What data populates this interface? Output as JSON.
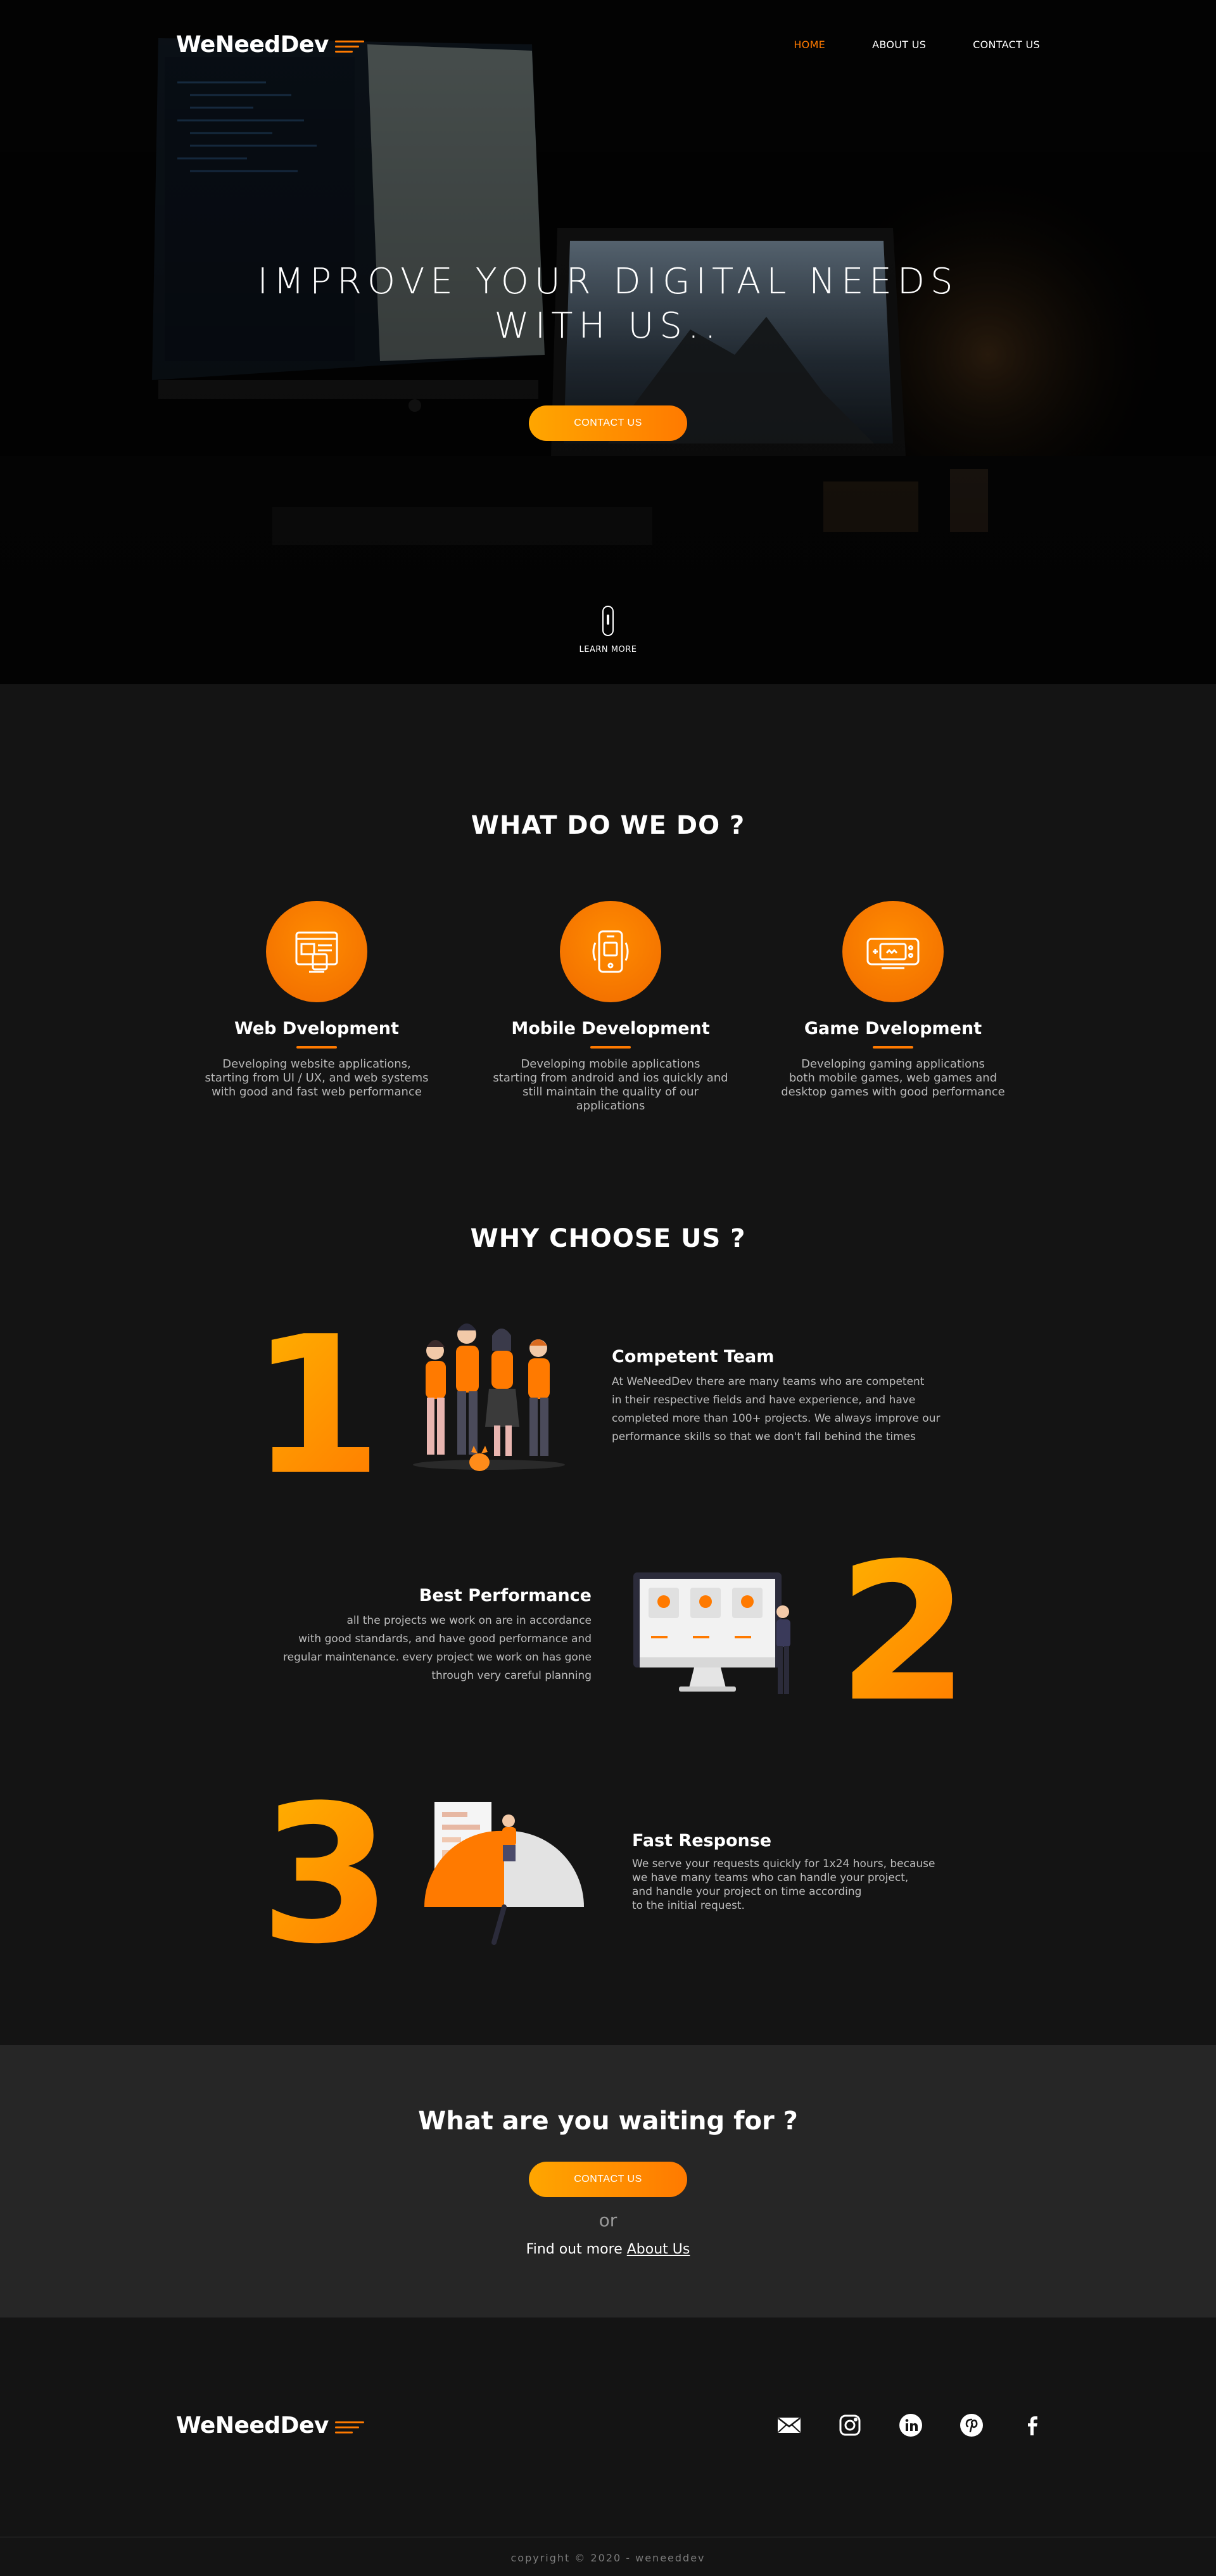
{
  "brand": {
    "name": "WeNeedDev",
    "accent": "#ff7a00"
  },
  "nav": {
    "items": [
      "HOME",
      "ABOUT US",
      "CONTACT US"
    ]
  },
  "hero": {
    "title_line1": "IMPROVE YOUR DIGITAL NEEDS",
    "title_line2": "WITH US..",
    "cta_label": "CONTACT US",
    "scroll_label": "LEARN MORE"
  },
  "services": {
    "title": "WHAT DO WE DO ?",
    "items": [
      {
        "icon": "web-icon",
        "title": "Web Dvelopment",
        "line1": "Developing website applications,",
        "line2": "starting from UI / UX, and web systems",
        "line3": "with good and fast web performance"
      },
      {
        "icon": "mobile-icon",
        "title": "Mobile Development",
        "line1": "Developing mobile applications",
        "line2": "starting from android and ios quickly and",
        "line3": "still maintain the quality of our applications"
      },
      {
        "icon": "gamepad-icon",
        "title": "Game Dvelopment",
        "line1": "Developing gaming applications",
        "line2": "both mobile games, web games and",
        "line3": "desktop games with good performance"
      }
    ]
  },
  "why": {
    "title": "WHY CHOOSE US ?",
    "items": [
      {
        "number": "1",
        "title": "Competent Team",
        "lines": [
          "At WeNeedDev there are many teams who are competent",
          "in their respective fields and have experience, and have",
          "completed more than 100+ projects. We always improve our",
          "performance skills so that we don't fall behind the times"
        ]
      },
      {
        "number": "2",
        "title": "Best Performance",
        "lines": [
          "all the projects we work on are in accordance",
          "with good standards, and have good performance and",
          "regular maintenance. every project we work on has gone",
          "through very careful planning"
        ]
      },
      {
        "number": "3",
        "title": "Fast Response",
        "lines": [
          "We serve your requests quickly for 1x24 hours, because",
          "we have many teams who can handle your project,",
          "and handle your project on time according",
          "to the initial request."
        ]
      }
    ]
  },
  "cta": {
    "title": "What are you waiting for ?",
    "button": "CONTACT US",
    "or": "or",
    "more_prefix": "Find out more",
    "more_link": "About Us"
  },
  "footer": {
    "socials": [
      "mail-icon",
      "instagram-icon",
      "linkedin-icon",
      "pinterest-icon",
      "facebook-icon"
    ],
    "copyright": "copyright © 2020 - weneeddev"
  }
}
